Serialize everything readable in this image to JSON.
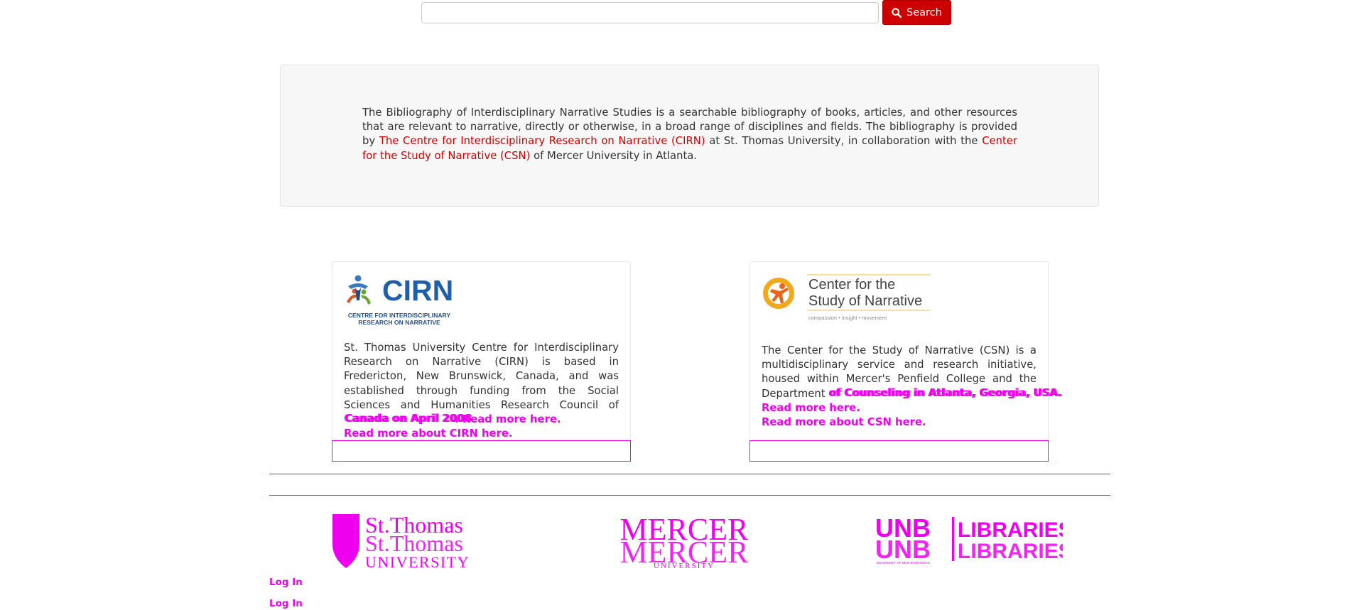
{
  "search": {
    "value": "",
    "placeholder": "",
    "button_label": "Search"
  },
  "intro": {
    "text_before": "The Bibliography of Interdisciplinary Narrative Studies is a searchable bibliography of books, articles, and other resources that are relevant to narrative, directly or otherwise, in a broad range of disciplines and fields. The bibliography is provided by ",
    "cirn_link": "The Centre for Interdisciplinary Research on Narrative (CIRN)",
    "text_middle": " at St. Thomas University, in collaboration with the ",
    "csn_link": "Center for the Study of Narrative (CSN)",
    "text_after": " of Mercer University in Atlanta."
  },
  "cirn_card": {
    "logo": {
      "acronym": "CIRN",
      "line1": "CENTRE FOR INTERDISCIPLINARY",
      "line2": "RESEARCH ON NARRATIVE"
    },
    "body_text": "St. Thomas University Centre for Interdisciplinary Research on Narrative (CIRN) is based in Fredericton, New Brunswick, Canada, and was established through funding from the Social Sciences and Humanities Research Council of ",
    "overlap_a": "Canada on April 2008",
    "overlap_b": "Canada on April 2006",
    "read_more": ". Read more here.",
    "about_link": "Read more about CIRN here."
  },
  "csn_card": {
    "logo": {
      "line1": "Center for the",
      "line2": "Study of Narrative",
      "tagline": "compassion   •   insight   •   movement"
    },
    "body_text": "The Center for the Study of Narrative (CSN) is a multidisciplinary service and research initiative, housed within Mercer's Penfield College and the Department ",
    "overlap_a": "of Counseling in Atlanta, Georgia, USA.",
    "overlap_b": "of Counseling in Atlanta, Georgia, USA.",
    "read_more": "Read more here.",
    "about_link": "Read more about CSN here."
  },
  "partners": {
    "stu": {
      "line1": "St.Thomas",
      "line2": "UNIVERSITY"
    },
    "mercer": {
      "line1": "MERCER",
      "line2": "UNIVERSITY"
    },
    "unb": {
      "left": "UNB",
      "right": "LIBRARIES",
      "small": "UNIVERSITY OF NEW BRUNSWICK"
    }
  },
  "footer": {
    "login_1": "Log In",
    "login_2": "Log In"
  },
  "colors": {
    "accent_red": "#cc0000",
    "debug_magenta": "#ee00ee",
    "panel_bg": "#f7f7f7"
  }
}
